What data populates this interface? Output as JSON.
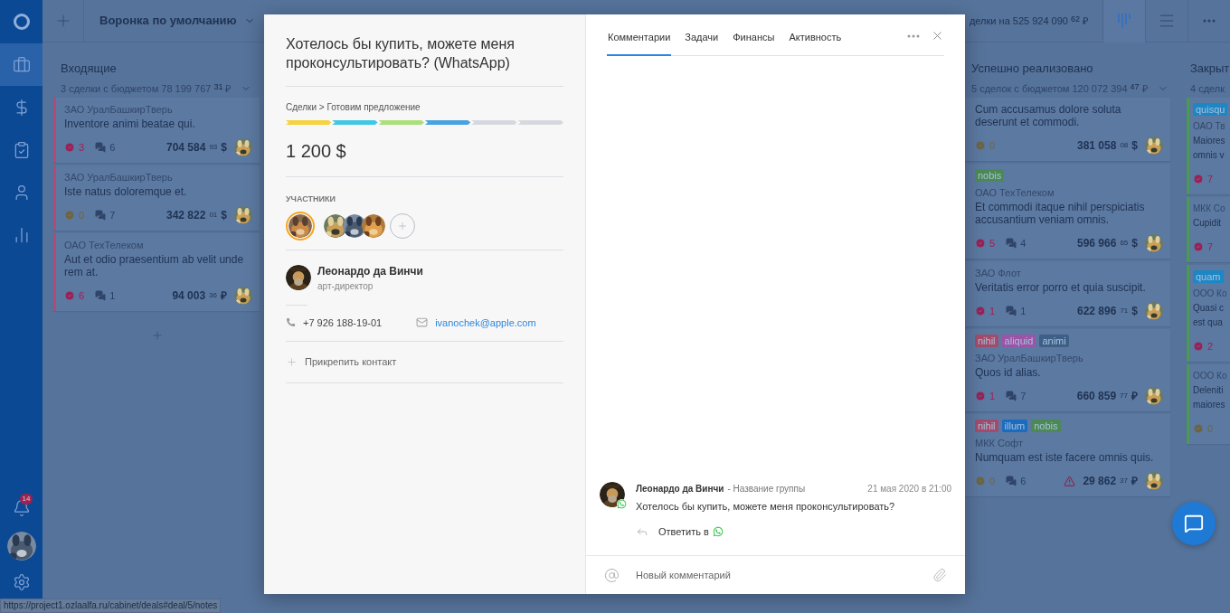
{
  "sidebar": {
    "items": [
      {
        "kind": "deals",
        "selected": true
      },
      {
        "kind": "finance",
        "selected": false
      },
      {
        "kind": "tasks",
        "selected": false
      },
      {
        "kind": "contacts",
        "selected": false
      },
      {
        "kind": "reports",
        "selected": false
      }
    ],
    "notifications_badge": "14"
  },
  "topbar": {
    "pipeline": "Воронка по умолчанию",
    "summary": "делки на 525 924 090",
    "summary_cents": "62",
    "summary_currency": "₽",
    "views": [
      {
        "kind": "kanban",
        "selected": true
      },
      {
        "kind": "list",
        "selected": false
      },
      {
        "kind": "more",
        "selected": false
      }
    ]
  },
  "columns": [
    {
      "title": "Входящие",
      "summary": "3 сделки с бюджетом 78 199 767",
      "cents": "31",
      "currency": "₽",
      "add_card": true,
      "cards": [
        {
          "color": "#b24a78",
          "company": "ЗАО УралБашкирТверь",
          "title": "Inventore animi beatae qui.",
          "tasks": {
            "count": "3",
            "color": "#9c1f55"
          },
          "comments": "6",
          "amount": "704 584",
          "cents": "93",
          "currency": "$"
        },
        {
          "color": "#b24a78",
          "company": "ЗАО УралБашкирТверь",
          "title": "Iste natus doloremque et.",
          "tasks": {
            "count": "0",
            "color": "#6e6540"
          },
          "comments": "7",
          "amount": "342 822",
          "cents": "01",
          "currency": "$"
        },
        {
          "color": "#b24a78",
          "company": "ОАО ТехТелеком",
          "title": "Aut et odio praesentium ab velit unde rem at.",
          "tasks": {
            "count": "6",
            "color": "#9c1f55"
          },
          "comments": "1",
          "amount": "94 003",
          "cents": "36",
          "currency": "₽"
        }
      ]
    },
    {
      "title": "Успешно реализовано",
      "summary": "5 сделок с бюджетом 120 072 394",
      "cents": "47",
      "currency": "₽",
      "cards": [
        {
          "title": "Cum accusamus dolore soluta deserunt et commodi.",
          "tasks": {
            "count": "0",
            "color": "#6e6540"
          },
          "amount": "381 058",
          "cents": "08",
          "currency": "$"
        },
        {
          "tags": [
            {
              "label": "nobis",
              "color": "#4c8a55"
            }
          ],
          "company": "ОАО ТехТелеком",
          "title": "Et commodi itaque nihil perspiciatis accusantium veniam omnis.",
          "tasks": {
            "count": "5",
            "color": "#9c1f55"
          },
          "comments": "4",
          "amount": "596 966",
          "cents": "65",
          "currency": "$"
        },
        {
          "company": "ЗАО Флот",
          "title": "Veritatis error porro et quia suscipit.",
          "tasks": {
            "count": "1",
            "color": "#9c1f55"
          },
          "comments": "1",
          "amount": "622 896",
          "cents": "71",
          "currency": "$"
        },
        {
          "tags": [
            {
              "label": "nihil",
              "color": "#a24c6c"
            },
            {
              "label": "aliquid",
              "color": "#9a55a6"
            },
            {
              "label": "animi",
              "color": "#3e5f86"
            }
          ],
          "company": "ЗАО УралБашкирТверь",
          "title": "Quos id alias.",
          "tasks": {
            "count": "1",
            "color": "#9c1f55"
          },
          "comments": "7",
          "amount": "660 859",
          "cents": "77",
          "currency": "₽"
        },
        {
          "tags": [
            {
              "label": "nihil",
              "color": "#a24c6c"
            },
            {
              "label": "illum",
              "color": "#1a6cc0"
            },
            {
              "label": "nobis",
              "color": "#4c8a55"
            }
          ],
          "company": "МКК Софт",
          "title": "Numquam est iste facere omnis quis.",
          "tasks": {
            "count": "0",
            "color": "#6e6540"
          },
          "comments": "6",
          "warning": true,
          "amount": "29 862",
          "cents": "37",
          "currency": "₽"
        }
      ]
    },
    {
      "title": "Закрыт",
      "summary": "4 сделк",
      "cards": [
        {
          "color": "#4c9a52",
          "tags": [
            {
              "label": "quisqu",
              "color": "#1d86c4"
            }
          ],
          "company": "ОАО Тв",
          "title_lines": [
            "Maiores",
            "omnis v"
          ],
          "tasks": {
            "count": "7",
            "color": "#9c1f55"
          }
        },
        {
          "color": "#4c9a52",
          "company": "МКК Со",
          "title_lines": [
            "Cupidit"
          ],
          "tasks": {
            "count": "7",
            "color": "#9c1f55"
          }
        },
        {
          "color": "#4c9a52",
          "tags": [
            {
              "label": "quam",
              "color": "#1d86c4"
            }
          ],
          "company": "ООО Ко",
          "title_lines": [
            "Quasi c",
            "est qua"
          ],
          "tasks": {
            "count": "2",
            "color": "#9c1f55"
          }
        },
        {
          "color": "#4c9a52",
          "company": "ООО Ко",
          "title_lines": [
            "Deleniti",
            "maiores"
          ],
          "tasks": {
            "count": "0",
            "color": "#6e6540"
          }
        }
      ]
    }
  ],
  "modal": {
    "title": "Хотелось бы купить, можете меня проконсультировать? (WhatsApp)",
    "breadcrumb": "Сделки > Готовим предложение",
    "stages": [
      {
        "color": "#f5d23e"
      },
      {
        "color": "#3fc8e3"
      },
      {
        "color": "#acde7b"
      },
      {
        "color": "#49a2e0"
      },
      {
        "color": "#d5d9de"
      },
      {
        "color": "#d5d9de"
      }
    ],
    "amount": "1 200 $",
    "participants_label": "УЧАСТНИКИ",
    "participants": [
      {
        "selected": true
      },
      {
        "selected": false
      },
      {
        "selected": false
      },
      {
        "selected": false
      }
    ],
    "contact": {
      "name": "Леонардо да Винчи",
      "role": "арт-директор",
      "phone": "+7 926 188-19-01",
      "email": "ivanochek@apple.com"
    },
    "attach": "Прикрепить контакт",
    "tabs": [
      {
        "label": "Комментарии",
        "selected": true
      },
      {
        "label": "Задачи",
        "selected": false
      },
      {
        "label": "Финансы",
        "selected": false
      },
      {
        "label": "Активность",
        "selected": false
      }
    ],
    "comments": [
      {
        "author": "Леонардо да Винчи",
        "group": "- Название группы",
        "date": "21 мая 2020 в 21:00",
        "text": "Хотелось бы купить, можете меня проконсультировать?",
        "kind": "whatsapp",
        "reply": "Ответить в"
      }
    ],
    "composer": {
      "placeholder": "Новый комментарий"
    }
  },
  "status_url": "https://project1.ozlaalfa.ru/cabinet/deals#deal/5/notes"
}
